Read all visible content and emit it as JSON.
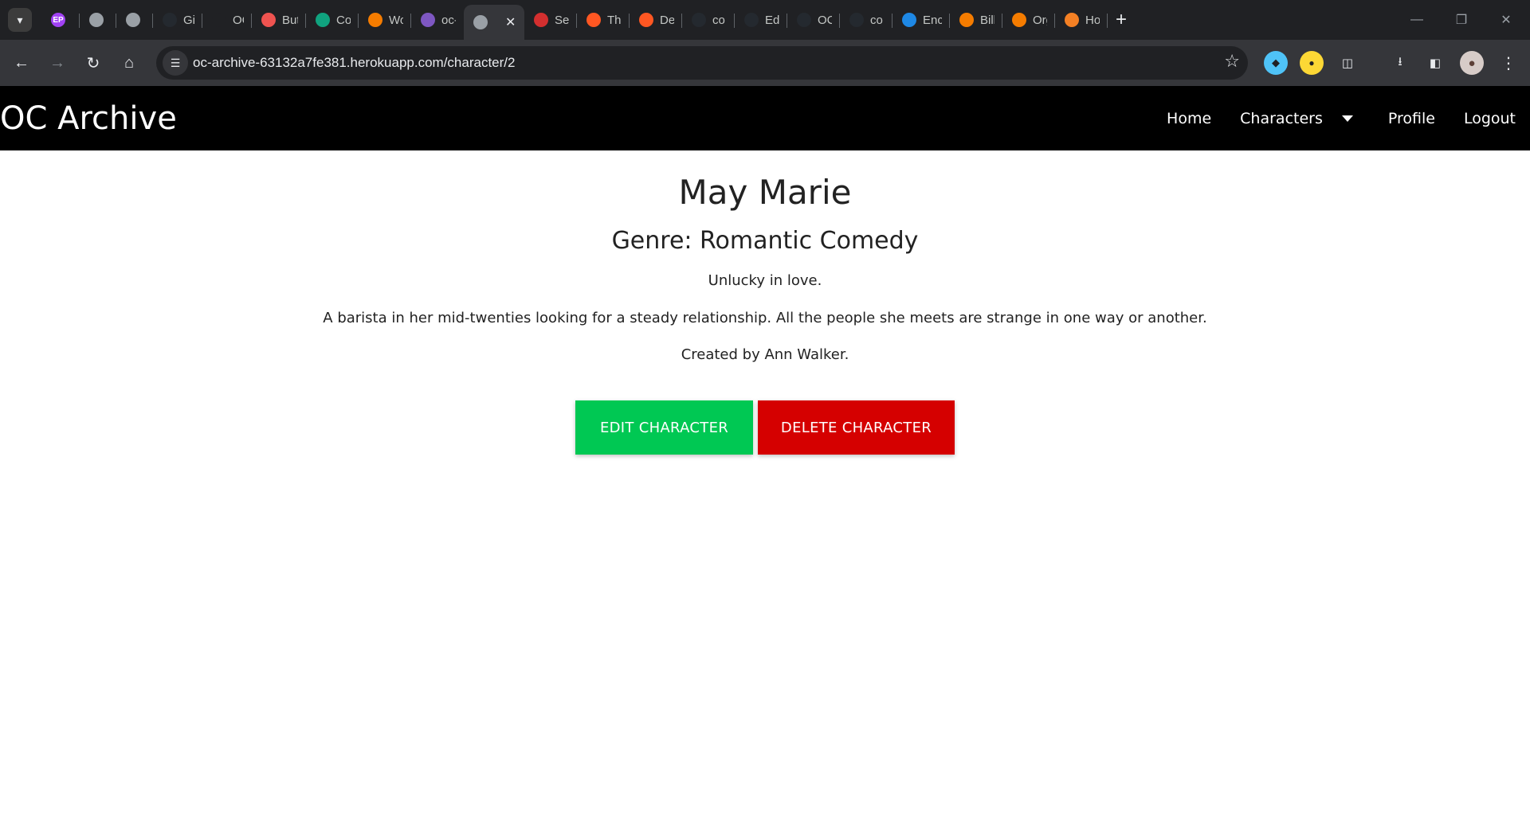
{
  "browser": {
    "tabs": [
      {
        "title": "",
        "icon": "ep-avatar-icon",
        "color": "#a142f4",
        "letter": "EP"
      },
      {
        "title": "",
        "icon": "globe-icon",
        "color": "#9aa0a6"
      },
      {
        "title": "",
        "icon": "globe-icon",
        "color": "#9aa0a6"
      },
      {
        "title": "Git",
        "icon": "github-icon",
        "color": "#24292f"
      },
      {
        "title": "OC",
        "icon": "git-branch-icon",
        "color": "#202124"
      },
      {
        "title": "But",
        "icon": "m-logo-icon",
        "color": "#ef5350"
      },
      {
        "title": "Co",
        "icon": "chatgpt-icon",
        "color": "#10a37f"
      },
      {
        "title": "Wo",
        "icon": "g-logo-icon",
        "color": "#f57c00"
      },
      {
        "title": "oc-",
        "icon": "heroku-icon",
        "color": "#7e57c2"
      },
      {
        "title": "",
        "icon": "globe-icon",
        "color": "#9aa0a6",
        "active": true
      },
      {
        "title": "Ser",
        "icon": "crab-icon",
        "color": "#d32f2f"
      },
      {
        "title": "The",
        "icon": "opera-icon",
        "color": "#ff5722"
      },
      {
        "title": "De",
        "icon": "opera-icon",
        "color": "#ff5722"
      },
      {
        "title": "co",
        "icon": "github-icon",
        "color": "#24292f"
      },
      {
        "title": "Edi",
        "icon": "github-icon",
        "color": "#24292f"
      },
      {
        "title": "OC",
        "icon": "github-icon",
        "color": "#24292f"
      },
      {
        "title": "co",
        "icon": "github-icon",
        "color": "#24292f"
      },
      {
        "title": "Enc",
        "icon": "wave-icon",
        "color": "#1e88e5"
      },
      {
        "title": "Bill",
        "icon": "g-logo-icon",
        "color": "#f57c00"
      },
      {
        "title": "Org",
        "icon": "g-logo-icon",
        "color": "#f57c00"
      },
      {
        "title": "Ho",
        "icon": "stack-icon",
        "color": "#f48024"
      }
    ],
    "url": "oc-archive-63132a7fe381.herokuapp.com/character/2"
  },
  "site": {
    "brand": "OC Archive",
    "nav": {
      "home": "Home",
      "characters": "Characters",
      "profile": "Profile",
      "logout": "Logout"
    }
  },
  "character": {
    "name": "May Marie",
    "genre": "Genre: Romantic Comedy",
    "tagline": "Unlucky in love.",
    "description": "A barista in her mid-twenties looking for a steady relationship. All the people she meets are strange in one way or another.",
    "creator": "Created by Ann Walker."
  },
  "actions": {
    "edit_label": "EDIT CHARACTER",
    "delete_label": "DELETE CHARACTER"
  },
  "colors": {
    "navbar": "#000000",
    "edit": "#00c853",
    "delete": "#d50000"
  }
}
